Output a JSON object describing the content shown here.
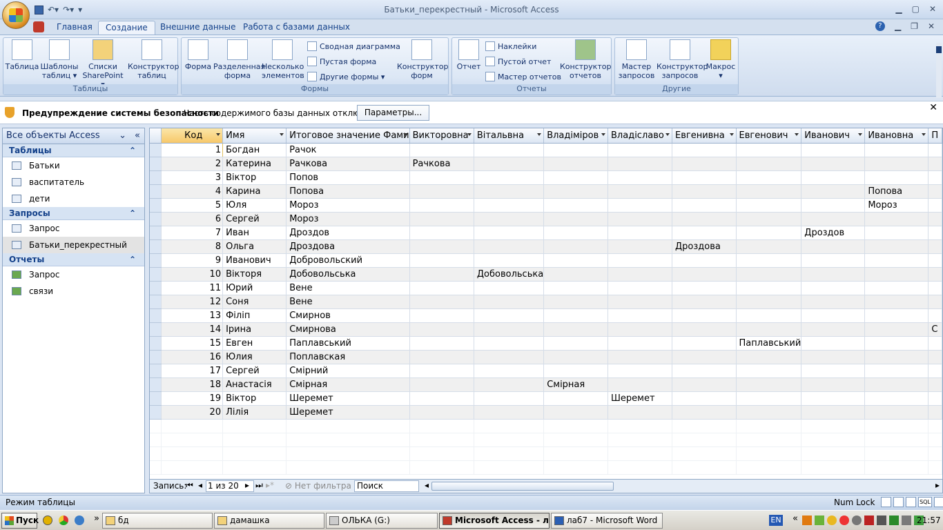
{
  "window": {
    "title": "Батьки_перекрестный - Microsoft Access"
  },
  "ribbon": {
    "tabs": [
      "Главная",
      "Создание",
      "Внешние данные",
      "Работа с базами данных"
    ],
    "groups": {
      "tables": {
        "label": "Таблицы",
        "buttons": [
          "Таблица",
          "Шаблоны таблиц ▾",
          "Списки SharePoint ▾",
          "Конструктор таблиц"
        ]
      },
      "forms": {
        "label": "Формы",
        "buttons": [
          "Форма",
          "Разделенная форма",
          "Несколько элементов"
        ],
        "small": [
          "Сводная диаграмма",
          "Пустая форма",
          "Другие формы ▾"
        ],
        "designer": "Конструктор форм"
      },
      "reports": {
        "label": "Отчеты",
        "buttons": [
          "Отчет"
        ],
        "small": [
          "Наклейки",
          "Пустой отчет",
          "Мастер отчетов"
        ],
        "designer": "Конструктор отчетов"
      },
      "other": {
        "label": "Другие",
        "buttons": [
          "Мастер запросов",
          "Конструктор запросов",
          "Макрос ▾"
        ]
      }
    }
  },
  "security": {
    "title": "Предупреждение системы безопасности",
    "message": "Часть содержимого базы данных отключено",
    "button": "Параметры..."
  },
  "nav": {
    "header": "Все объекты Access",
    "sections": [
      {
        "label": "Таблицы",
        "items": [
          "Батьки",
          "васпитатель",
          "дети"
        ]
      },
      {
        "label": "Запросы",
        "items": [
          "Запрос",
          "Батьки_перекрестный"
        ]
      },
      {
        "label": "Отчеты",
        "items": [
          "Запрос",
          "связи"
        ]
      }
    ]
  },
  "grid": {
    "columns": [
      "Код",
      "Имя",
      "Итоговое значение Фами",
      "Викторовна",
      "Вітальвна",
      "Владіміров",
      "Владіславо",
      "Евгенивна",
      "Евгенович",
      "Иванович",
      "Ивановна",
      "П"
    ],
    "rows": [
      [
        "1",
        "Богдан",
        "Рачок",
        "",
        "",
        "",
        "",
        "",
        "",
        "",
        "",
        ""
      ],
      [
        "2",
        "Катерина",
        "Рачкова",
        "Рачкова",
        "",
        "",
        "",
        "",
        "",
        "",
        "",
        ""
      ],
      [
        "3",
        "Віктор",
        "Попов",
        "",
        "",
        "",
        "",
        "",
        "",
        "",
        "",
        ""
      ],
      [
        "4",
        "Карина",
        "Попова",
        "",
        "",
        "",
        "",
        "",
        "",
        "",
        "Попова",
        ""
      ],
      [
        "5",
        "Юля",
        "Мороз",
        "",
        "",
        "",
        "",
        "",
        "",
        "",
        "Мороз",
        ""
      ],
      [
        "6",
        "Сергей",
        "Мороз",
        "",
        "",
        "",
        "",
        "",
        "",
        "",
        "",
        ""
      ],
      [
        "7",
        "Иван",
        "Дроздов",
        "",
        "",
        "",
        "",
        "",
        "",
        "Дроздов",
        "",
        ""
      ],
      [
        "8",
        "Ольга",
        "Дроздова",
        "",
        "",
        "",
        "",
        "Дроздова",
        "",
        "",
        "",
        ""
      ],
      [
        "9",
        "Иванович",
        "Добровольский",
        "",
        "",
        "",
        "",
        "",
        "",
        "",
        "",
        ""
      ],
      [
        "10",
        "Вікторя",
        "Добовольська",
        "",
        "Добовольська",
        "",
        "",
        "",
        "",
        "",
        "",
        ""
      ],
      [
        "11",
        "Юрий",
        "Вене",
        "",
        "",
        "",
        "",
        "",
        "",
        "",
        "",
        ""
      ],
      [
        "12",
        "Соня",
        "Вене",
        "",
        "",
        "",
        "",
        "",
        "",
        "",
        "",
        ""
      ],
      [
        "13",
        "Філіп",
        "Смирнов",
        "",
        "",
        "",
        "",
        "",
        "",
        "",
        "",
        ""
      ],
      [
        "14",
        "Ірина",
        "Смирнова",
        "",
        "",
        "",
        "",
        "",
        "",
        "",
        "",
        "С"
      ],
      [
        "15",
        "Евген",
        "Паплавський",
        "",
        "",
        "",
        "",
        "",
        "Паплавський",
        "",
        "",
        ""
      ],
      [
        "16",
        "Юлия",
        "Поплавская",
        "",
        "",
        "",
        "",
        "",
        "",
        "",
        "",
        ""
      ],
      [
        "17",
        "Сергей",
        "Смірний",
        "",
        "",
        "",
        "",
        "",
        "",
        "",
        "",
        ""
      ],
      [
        "18",
        "Анастасія",
        "Смірная",
        "",
        "",
        "Смірная",
        "",
        "",
        "",
        "",
        "",
        ""
      ],
      [
        "19",
        "Віктор",
        "Шеремет",
        "",
        "",
        "",
        "Шеремет",
        "",
        "",
        "",
        "",
        ""
      ],
      [
        "20",
        "Лілія",
        "Шеремет",
        "",
        "",
        "",
        "",
        "",
        "",
        "",
        "",
        ""
      ]
    ]
  },
  "recnav": {
    "label": "Запись:",
    "position": "1 из 20",
    "filter": "Нет фильтра",
    "search": "Поиск"
  },
  "status": {
    "left": "Режим таблицы",
    "numlock": "Num Lock"
  },
  "taskbar": {
    "start": "Пуск",
    "tasks": [
      "бд",
      "дамашка",
      "ОЛЬКА (G:)",
      "Microsoft Access - л...",
      "лаб7 - Microsoft Word"
    ],
    "lang": "EN",
    "clock": "21:57"
  }
}
